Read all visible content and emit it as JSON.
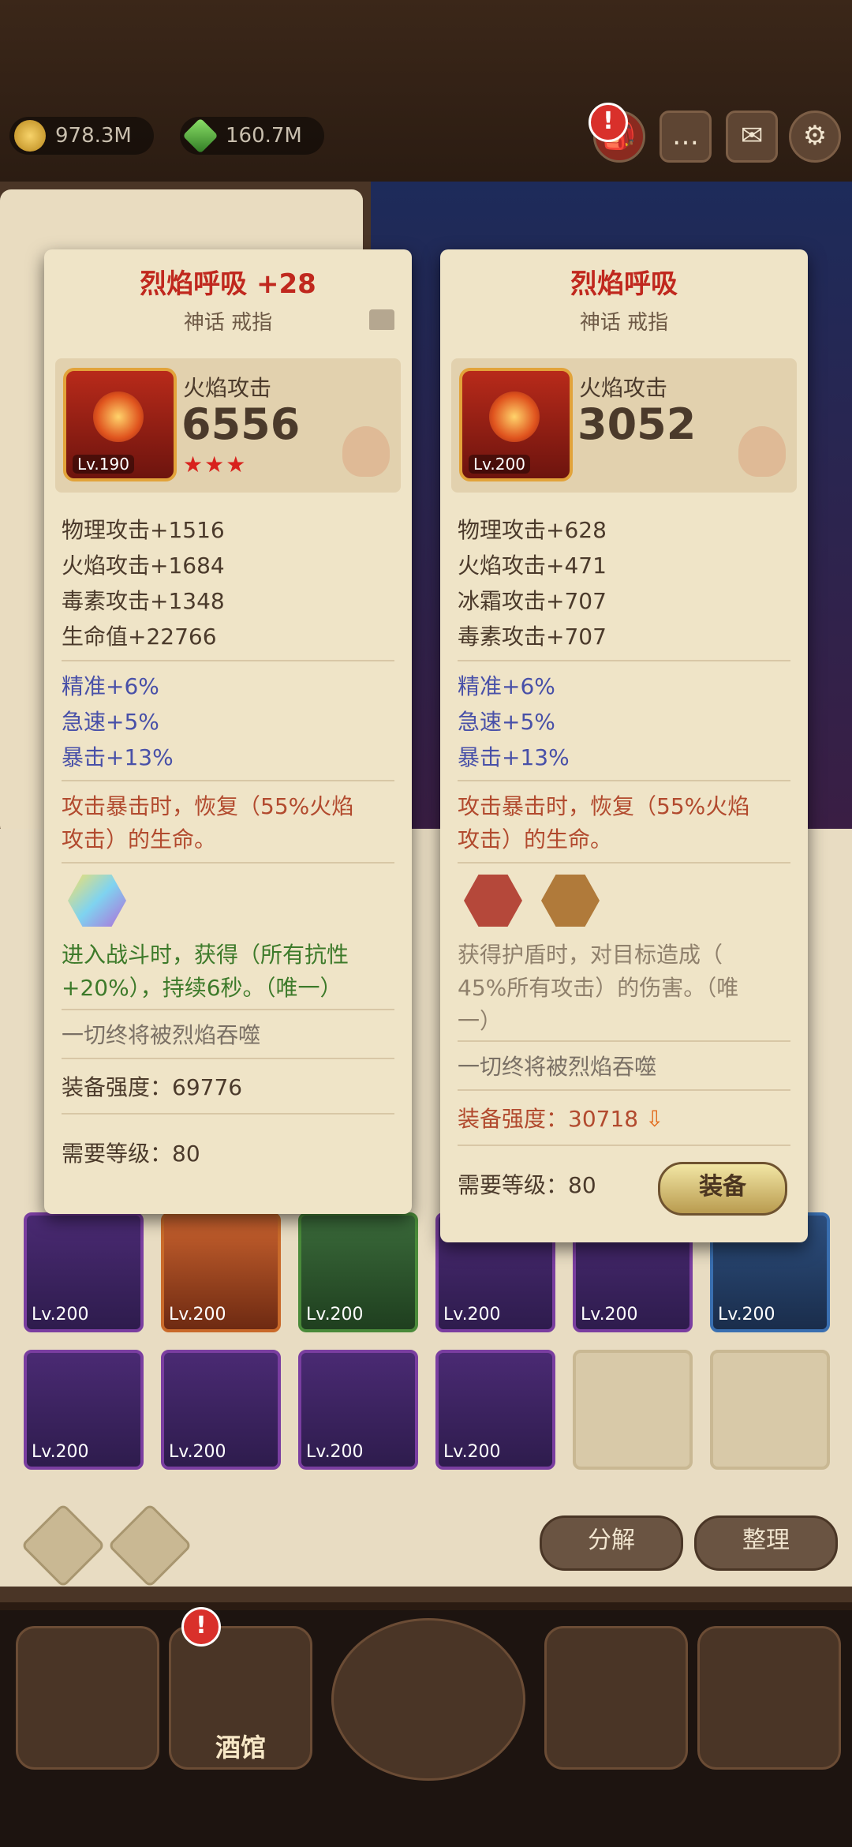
{
  "resources": {
    "gold": "978.3M",
    "gems": "160.7M"
  },
  "top_icons": [
    "backpack-icon",
    "chat-icon",
    "mail-icon",
    "settings-icon"
  ],
  "alert_mark": "!",
  "left_card": {
    "title": "烈焰呼吸 +28",
    "subtitle": "神话 戒指",
    "head_label": "火焰攻击",
    "head_value": "6556",
    "level": "Lv.190",
    "stars": "★★★",
    "stats": [
      "物理攻击+1516",
      "火焰攻击+1684",
      "毒素攻击+1348",
      "生命值+22766"
    ],
    "bonus": [
      "精准+6%",
      "急速+5%",
      "暴击+13%"
    ],
    "effect": [
      "攻击暴击时，恢复（55%火焰",
      "攻击）的生命。"
    ],
    "socket_effect": [
      "进入战斗时，获得（所有抗性",
      "+20%），持续6秒。（唯一）"
    ],
    "flavor": "一切终将被烈焰吞噬",
    "strength": "装备强度：69776",
    "required_level": "需要等级：80"
  },
  "right_card": {
    "title": "烈焰呼吸",
    "subtitle": "神话 戒指",
    "head_label": "火焰攻击",
    "head_value": "3052",
    "level": "Lv.200",
    "stats": [
      "物理攻击+628",
      "火焰攻击+471",
      "冰霜攻击+707",
      "毒素攻击+707"
    ],
    "bonus": [
      "精准+6%",
      "急速+5%",
      "暴击+13%"
    ],
    "effect": [
      "攻击暴击时，恢复（55%火焰",
      "攻击）的生命。"
    ],
    "socket_effect": [
      "获得护盾时，对目标造成（",
      "45%所有攻击）的伤害。（唯",
      "一）"
    ],
    "flavor": "一切终将被烈焰吞噬",
    "strength": "装备强度：30718",
    "required_level": "需要等级：80",
    "equip_label": "装备"
  },
  "inventory": {
    "row1": [
      "Lv.200",
      "Lv.200",
      "Lv.200",
      "Lv.200",
      "Lv.200",
      "Lv.200"
    ],
    "row2": [
      "Lv.200",
      "Lv.200",
      "Lv.200",
      "Lv.200"
    ]
  },
  "actions": {
    "decompose": "分解",
    "organize": "整理"
  },
  "nav": {
    "tavern": "酒馆"
  },
  "colors": {
    "title_red": "#c0281e",
    "bonus_blue": "#4850a8",
    "effect_red": "#b24a2e",
    "socket_green": "#3d7a2a",
    "card_bg": "#efe4c7"
  }
}
